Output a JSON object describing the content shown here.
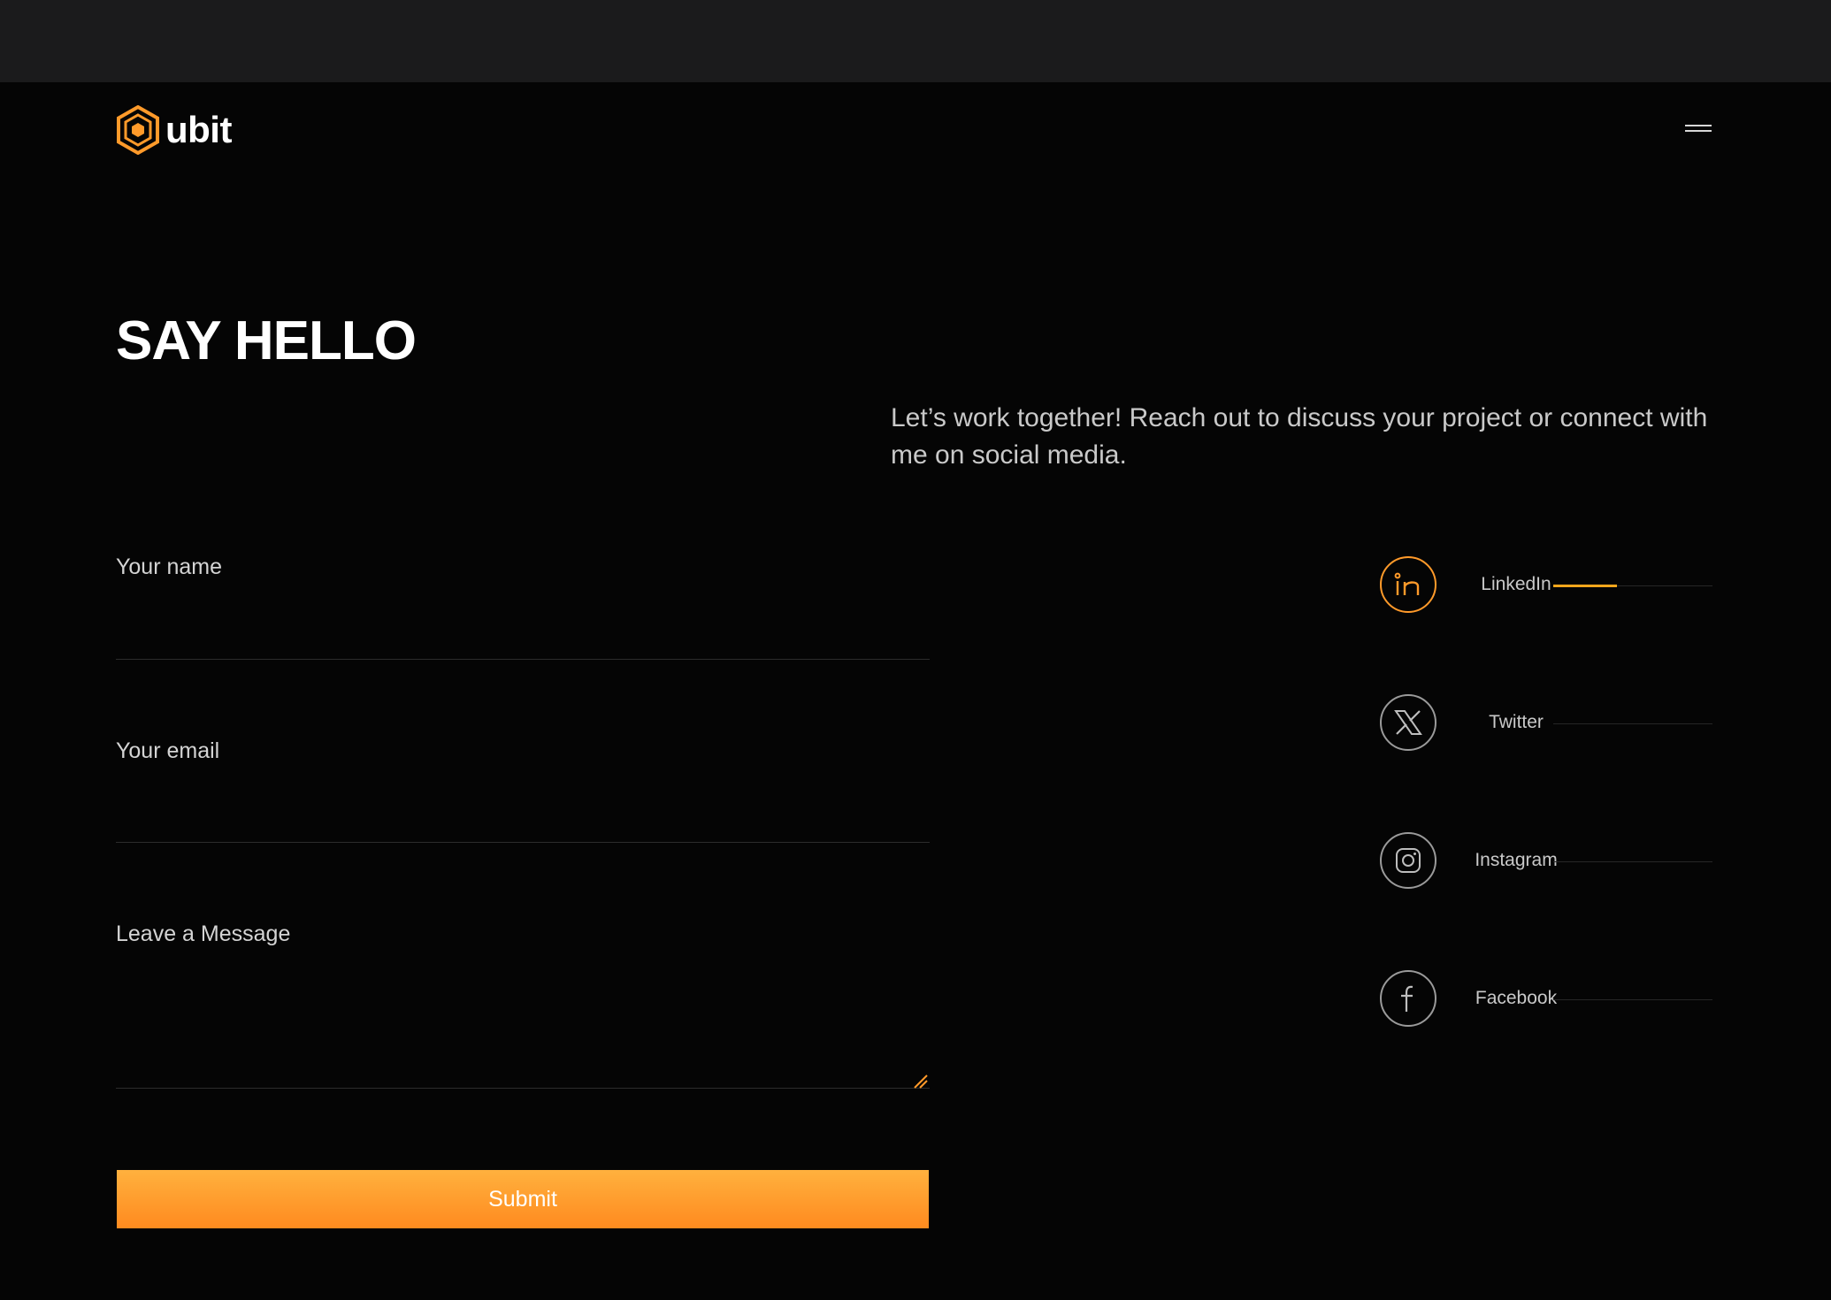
{
  "header": {
    "logo_text": "ubit",
    "menu_icon": "hamburger-icon"
  },
  "colors": {
    "accent": "#ff9a2a",
    "button_gradient_top": "#ffb13e",
    "button_gradient_bottom": "#ff8a1f",
    "background": "#050505",
    "topbar": "#1b1b1c"
  },
  "hero": {
    "title": "SAY HELLO",
    "intro": "Let’s work together! Reach out to discuss your project or connect with me on social media."
  },
  "form": {
    "name_label": "Your name",
    "name_value": "",
    "email_label": "Your email",
    "email_value": "",
    "message_label": "Leave a Message",
    "message_value": "",
    "submit_label": "Submit"
  },
  "social": [
    {
      "label": "LinkedIn",
      "icon": "linkedin-icon",
      "active": true,
      "progress": 0.4
    },
    {
      "label": "Twitter",
      "icon": "x-twitter-icon",
      "active": false,
      "progress": 0
    },
    {
      "label": "Instagram",
      "icon": "instagram-icon",
      "active": false,
      "progress": 0
    },
    {
      "label": "Facebook",
      "icon": "facebook-icon",
      "active": false,
      "progress": 0
    }
  ]
}
